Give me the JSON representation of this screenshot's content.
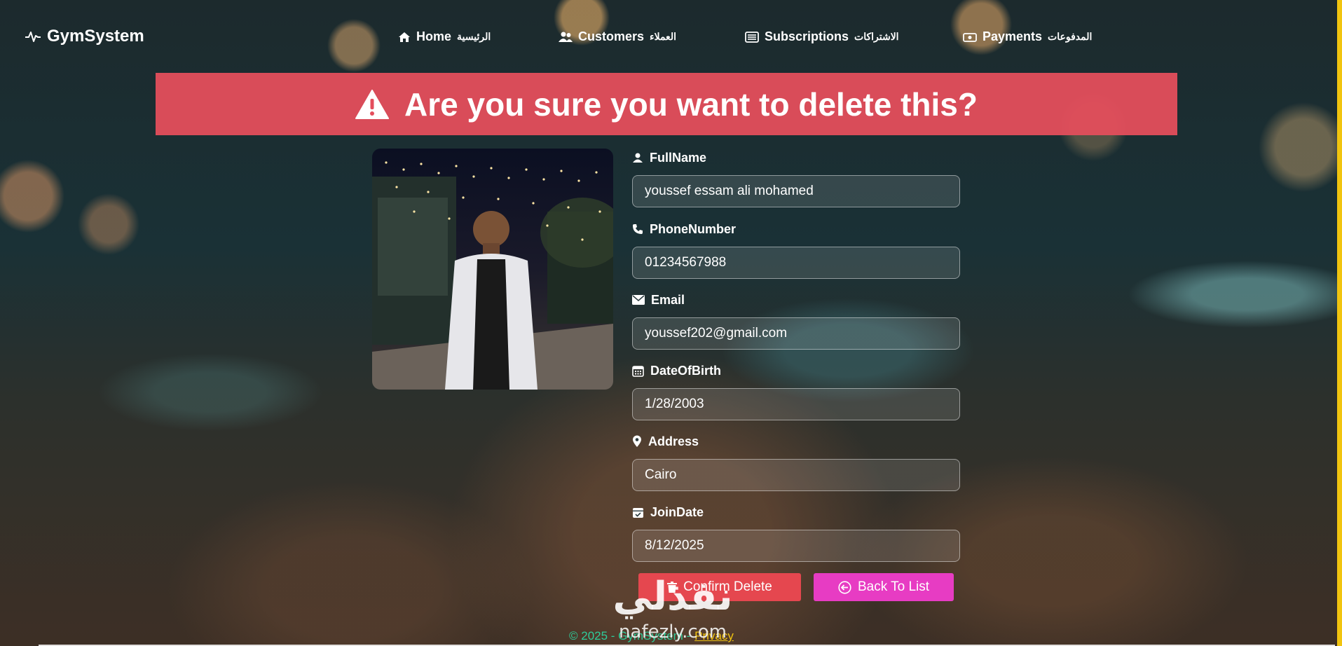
{
  "navbar": {
    "brand": "GymSystem",
    "items": [
      {
        "label": "Home",
        "arabic": "الرئيسية"
      },
      {
        "label": "Customers",
        "arabic": "العملاء"
      },
      {
        "label": "Subscriptions",
        "arabic": "الاشتراكات"
      },
      {
        "label": "Payments",
        "arabic": "المدفوعات"
      }
    ]
  },
  "banner": {
    "title": "Are you sure you want to delete this?"
  },
  "fields": [
    {
      "label": "FullName",
      "value": "youssef essam ali mohamed",
      "icon": "person-icon"
    },
    {
      "label": "PhoneNumber",
      "value": "01234567988",
      "icon": "phone-icon"
    },
    {
      "label": "Email",
      "value": "youssef202@gmail.com",
      "icon": "envelope-icon"
    },
    {
      "label": "DateOfBirth",
      "value": "1/28/2003",
      "icon": "calendar-grid-icon"
    },
    {
      "label": "Address",
      "value": "Cairo",
      "icon": "location-pin-icon"
    },
    {
      "label": "JoinDate",
      "value": "8/12/2025",
      "icon": "calendar-check-icon"
    }
  ],
  "buttons": {
    "confirm_delete": "Confirm Delete",
    "back_to_list": "Back To List"
  },
  "footer": {
    "copyright": "© 2025 - GymSystem -",
    "privacy": "Privacy"
  },
  "watermark": {
    "arabic": "نفذلي",
    "latin": "nafezly.com"
  },
  "colors": {
    "danger": "#e5474f",
    "accent_pink": "#e73cc3",
    "footer_text": "#2ecc9a",
    "link_yellow": "#f1c40f"
  }
}
